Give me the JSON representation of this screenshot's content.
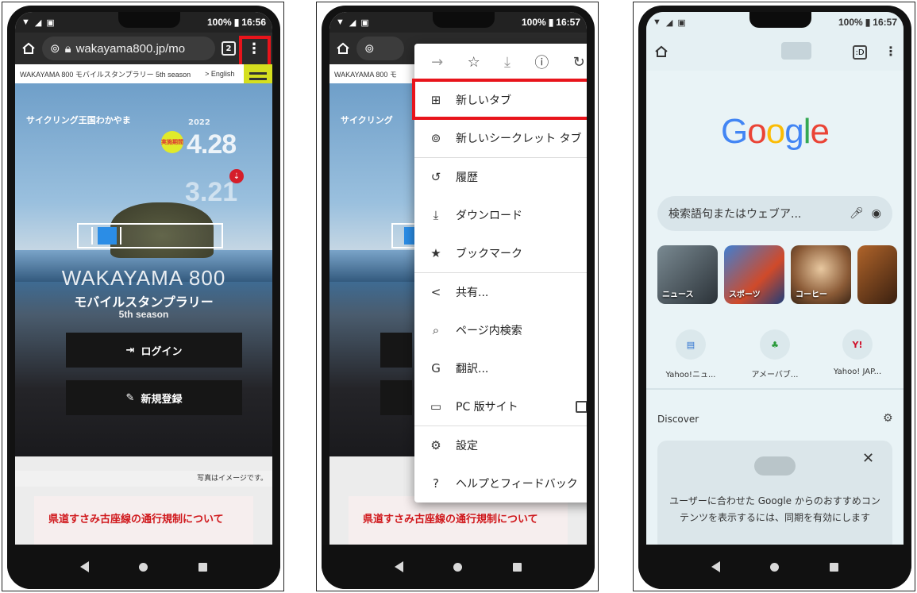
{
  "panel1": {
    "status": {
      "battery": "100%",
      "time": "16:56"
    },
    "url": "wakayama800.jp/mo",
    "tab_count": "2",
    "site_header": "WAKAYAMA 800 モバイルスタンプラリー 5th season",
    "english_link": "> English",
    "hero_caption": "サイクリング王国わかやま",
    "badge_text": "実施期間",
    "date_year": "2022",
    "date_start": "4.28",
    "date_end": "3.21",
    "title_main": "WAKAYAMA 800",
    "title_sub": "モバイルスタンプラリー",
    "title_season": "5th season",
    "login_label": "ログイン",
    "register_label": "新規登録",
    "photo_note": "写真はイメージです。",
    "notice_title": "県道すさみ古座線の通行規制について"
  },
  "panel2": {
    "status": {
      "battery": "100%",
      "time": "16:57"
    },
    "site_header": "WAKAYAMA 800 モ",
    "hero_caption": "サイクリング",
    "menu": {
      "items": [
        {
          "icon": "new-tab-icon",
          "label": "新しいタブ"
        },
        {
          "icon": "incognito-icon",
          "label": "新しいシークレット タブ"
        },
        {
          "icon": "history-icon",
          "label": "履歴"
        },
        {
          "icon": "downloads-icon",
          "label": "ダウンロード"
        },
        {
          "icon": "star-icon",
          "label": "ブックマーク"
        },
        {
          "icon": "share-icon",
          "label": "共有..."
        },
        {
          "icon": "find-in-page-icon",
          "label": "ページ内検索"
        },
        {
          "icon": "translate-icon",
          "label": "翻訳..."
        },
        {
          "icon": "desktop-icon",
          "label": "PC 版サイト"
        },
        {
          "icon": "gear-icon",
          "label": "設定"
        },
        {
          "icon": "help-icon",
          "label": "ヘルプとフィードバック"
        }
      ]
    },
    "notice_title": "県道すさみ古座線の通行規制について"
  },
  "panel3": {
    "status": {
      "battery": "100%",
      "time": "16:57"
    },
    "tab_count": ":D",
    "logo": [
      "G",
      "o",
      "o",
      "g",
      "l",
      "e"
    ],
    "logo_colors": [
      "#4285F4",
      "#EA4335",
      "#FBBC05",
      "#4285F4",
      "#34A853",
      "#EA4335"
    ],
    "search_placeholder": "検索語句またはウェブア...",
    "tiles": [
      "ニュース",
      "スポーツ",
      "コーヒー",
      ""
    ],
    "shortcuts": [
      {
        "label": "Yahoo!ニュ...",
        "icon": "yahoo-news-icon"
      },
      {
        "label": "アメーバブ...",
        "icon": "ameba-icon"
      },
      {
        "label": "Yahoo! JAP...",
        "icon": "yahoo-icon"
      }
    ],
    "discover_label": "Discover",
    "card_text": "ユーザーに合わせた Google からのおすすめコンテンツを表示するには、同期を有効にします"
  },
  "colors": {
    "highlight": "#e8141b",
    "accent_blue": "#2b8de6",
    "menu_lime": "#d5df1f"
  }
}
